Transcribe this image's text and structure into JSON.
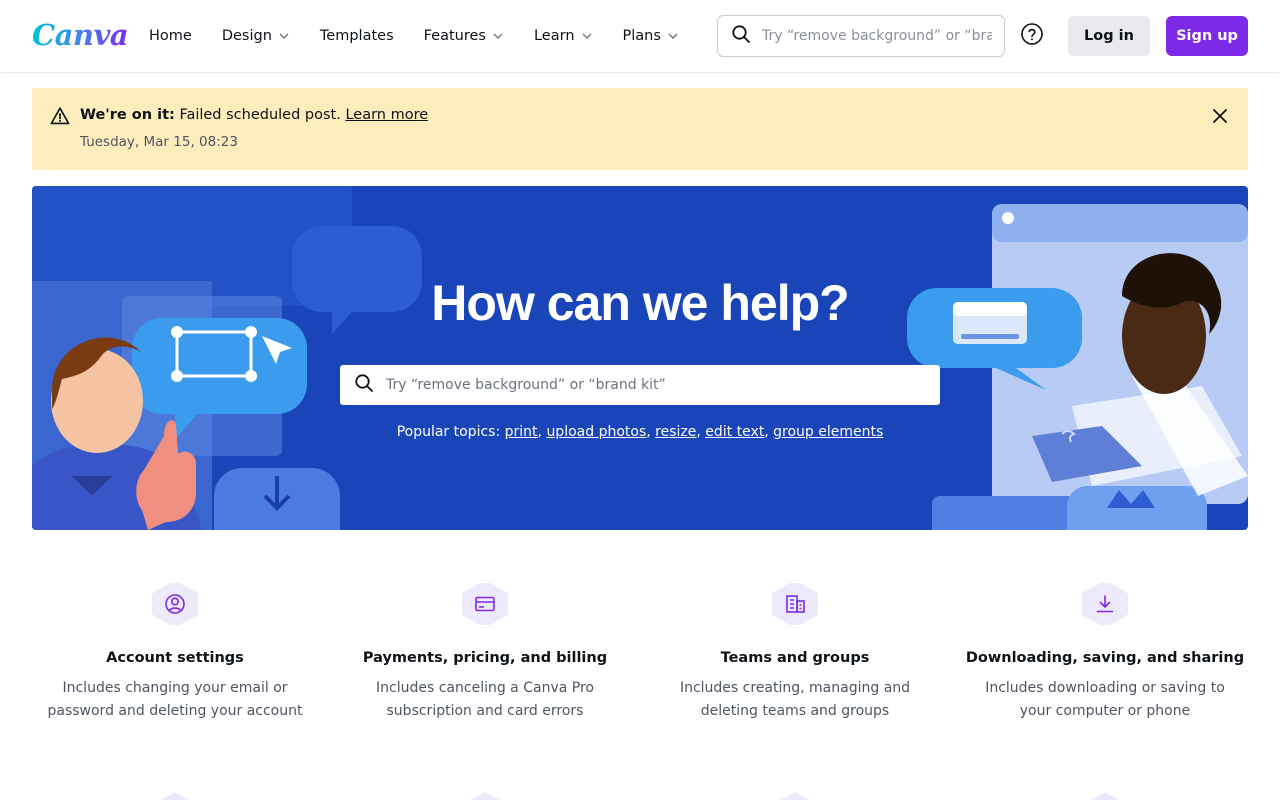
{
  "header": {
    "logo_text": "Canva",
    "nav": [
      {
        "label": "Home",
        "has_dropdown": false
      },
      {
        "label": "Design",
        "has_dropdown": true
      },
      {
        "label": "Templates",
        "has_dropdown": false
      },
      {
        "label": "Features",
        "has_dropdown": true
      },
      {
        "label": "Learn",
        "has_dropdown": true
      },
      {
        "label": "Plans",
        "has_dropdown": true
      }
    ],
    "search_placeholder": "Try “remove background” or “brand kit”",
    "help_icon": "question-circle-icon",
    "login_label": "Log in",
    "signup_label": "Sign up"
  },
  "alert": {
    "bold_text": "We're on it:",
    "message": "Failed scheduled post.",
    "link_text": "Learn more",
    "timestamp": "Tuesday, Mar 15, 08:23",
    "icon": "warning-triangle-icon",
    "close_icon": "close-icon"
  },
  "hero": {
    "title": "How can we help?",
    "search_placeholder": "Try “remove background” or “brand kit”",
    "popular_label": "Popular topics:",
    "topics": [
      "print",
      "upload photos",
      "resize",
      "edit text",
      "group elements"
    ]
  },
  "categories": [
    {
      "icon": "account-circle-icon",
      "title": "Account settings",
      "description": "Includes changing your email or password and deleting your account"
    },
    {
      "icon": "credit-card-icon",
      "title": "Payments, pricing, and billing",
      "description": "Includes canceling a Canva Pro subscription and card errors"
    },
    {
      "icon": "building-icon",
      "title": "Teams and groups",
      "description": "Includes creating, managing and deleting teams and groups"
    },
    {
      "icon": "download-icon",
      "title": "Downloading, saving, and sharing",
      "description": "Includes downloading or saving to your computer or phone"
    }
  ],
  "colors": {
    "brand_purple": "#7d2ae8",
    "hero_blue": "#1a45b8",
    "alert_yellow": "#fdedbd",
    "icon_bg": "#ece9fb"
  }
}
